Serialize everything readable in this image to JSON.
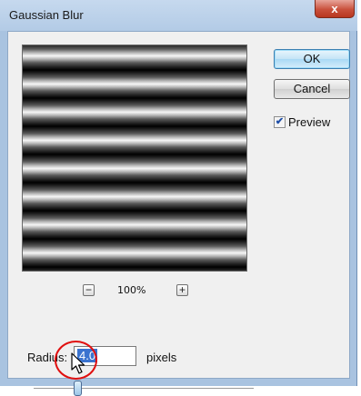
{
  "window": {
    "title": "Gaussian Blur",
    "close_glyph": "x"
  },
  "buttons": {
    "ok_label": "OK",
    "cancel_label": "Cancel"
  },
  "preview": {
    "checkbox_label": "Preview",
    "checked": true,
    "checkmark_glyph": "✔"
  },
  "zoom": {
    "out_glyph": "−",
    "in_glyph": "+",
    "level": "100%"
  },
  "radius": {
    "label": "Radius:",
    "value": "4.0",
    "units": "pixels",
    "slider_fraction": 0.2
  },
  "icons": {
    "cursor": "arrow-cursor-icon",
    "annotation": "red-circle-highlight"
  },
  "colors": {
    "highlight": "#e01010",
    "selection": "#3a73cf"
  }
}
